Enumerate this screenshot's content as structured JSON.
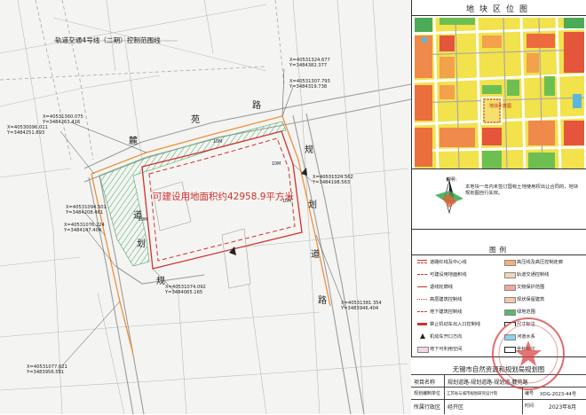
{
  "map": {
    "rail_label": "轨道交通4号线（二期）控制范围线",
    "area_label": "可建设用地面积约42958.9平方米",
    "road_chars": [
      "路",
      "规",
      "划",
      "道",
      "规",
      "划",
      "道",
      "路",
      "麓",
      "苑"
    ],
    "scale_marks": [
      "10M",
      "10M",
      "10M",
      "10M"
    ],
    "coords": [
      {
        "x": "X=40530096.011",
        "y": "Y=3484251.893"
      },
      {
        "x": "X=40531360.075",
        "y": "Y=3484263.416"
      },
      {
        "x": "X=40531324.677",
        "y": "Y=3484382.377"
      },
      {
        "x": "X=40531307.793",
        "y": "Y=3484319.738"
      },
      {
        "x": "X=40531324.562",
        "y": "Y=3484198.563"
      },
      {
        "x": "X=40531094.501",
        "y": "Y=3484208.461"
      },
      {
        "x": "X=40531076.224",
        "y": "Y=3484147.404"
      },
      {
        "x": "X=40531074.092",
        "y": "Y=3484065.165"
      },
      {
        "x": "X=40531381.354",
        "y": "Y=3483946.404"
      },
      {
        "x": "X=40531077.621",
        "y": "Y=3483956.581"
      }
    ]
  },
  "location": {
    "title": "地块区位图",
    "tag": "地块示意图",
    "note_label": "说明：",
    "note_text": "本地块一年内未签订国有土地使用权出让合同的，地块规划图自行失效。",
    "compass_label": "N"
  },
  "legend": {
    "title": "图例",
    "items": [
      {
        "label": "道路红线及中心线",
        "color": "#d0312d",
        "style": "line"
      },
      {
        "label": "高压线及高压控制走廊",
        "color": "#f2b27a",
        "style": "fill"
      },
      {
        "label": "可建设用地面积线",
        "color": "#d0312d",
        "style": "dash"
      },
      {
        "label": "轨道交通控制线",
        "color": "#efd9b8",
        "style": "fill"
      },
      {
        "label": "退线轮廓线",
        "color": "#d0312d",
        "style": "thin"
      },
      {
        "label": "文物保护范围",
        "color": "#f4a6a0",
        "style": "fill"
      },
      {
        "label": "高层建筑控制线",
        "color": "#d0312d",
        "style": "dot"
      },
      {
        "label": "现状保留建筑",
        "color": "#f7c6a8",
        "style": "fill"
      },
      {
        "label": "地下建筑控制线",
        "color": "#d0312d",
        "style": "dashdot"
      },
      {
        "label": "绿地范围",
        "color": "#59b86a",
        "style": "fill"
      },
      {
        "label": "禁止机动车出入口控制线",
        "color": "#d0312d",
        "style": "thick"
      },
      {
        "label": "尺寸标注",
        "color": "#222222",
        "style": "dim"
      },
      {
        "label": "机动车开口方向",
        "color": "#222222",
        "style": "arrow"
      },
      {
        "label": "河道水系",
        "color": "#8fd0e8",
        "style": "fill"
      },
      {
        "label": "地下可利用空间",
        "color": "#f3d6e6",
        "style": "fill"
      },
      {
        "label": "坐标标注",
        "color": "#222222",
        "style": "coord"
      }
    ]
  },
  "title_block": {
    "org": "无锡市自然资源和规划局规划图",
    "row1_label": "项目名称",
    "row1_value": "规划道路-规划道路-规划道-麓苑路",
    "row2_label": "规划编制单位",
    "row2_value": "江苏省与城市规划研究设计院",
    "row2_no_label": "编号",
    "row2_no": "XDG-2023-44号",
    "row3_label": "所属行政区",
    "row3_value": "经开区",
    "row3_date_label": "时间",
    "row3_date": "2023年8月"
  }
}
